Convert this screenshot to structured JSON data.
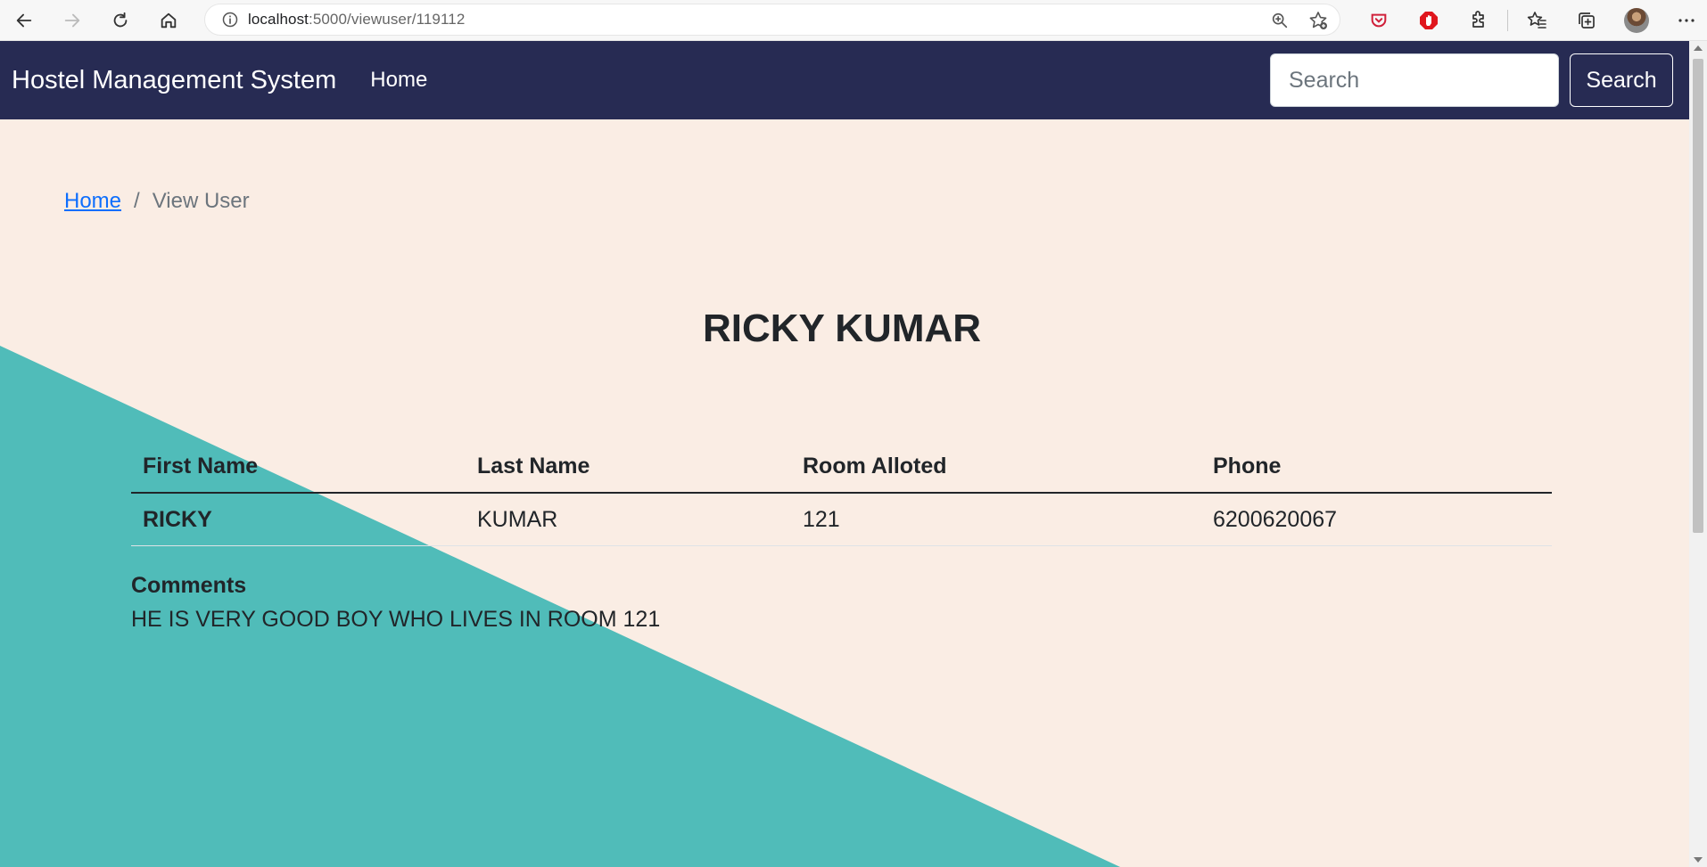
{
  "browser": {
    "url_host": "localhost",
    "url_path": ":5000/viewuser/119112"
  },
  "navbar": {
    "brand": "Hostel Management System",
    "home_link": "Home",
    "search_placeholder": "Search",
    "search_button": "Search"
  },
  "breadcrumb": {
    "home": "Home",
    "separator": "/",
    "current": "View User"
  },
  "user": {
    "title": "RICKY KUMAR"
  },
  "table": {
    "headers": [
      "First Name",
      "Last Name",
      "Room Alloted",
      "Phone"
    ],
    "row": {
      "first_name": "RICKY",
      "last_name": "KUMAR",
      "room": "121",
      "phone": "6200620067"
    }
  },
  "comments": {
    "label": "Comments",
    "text": "HE IS VERY GOOD BOY WHO LIVES IN ROOM 121"
  },
  "colors": {
    "navbar_bg": "#272b53",
    "page_bg": "#faede4",
    "teal_accent": "#50bcb9",
    "link": "#0d6efd"
  },
  "icons": [
    "back-icon",
    "forward-icon",
    "reload-icon",
    "home-icon",
    "info-icon",
    "zoom-icon",
    "favorite-add-icon",
    "pocket-icon",
    "opera-adblock-icon",
    "extensions-icon",
    "favorites-icon",
    "collections-icon",
    "profile-avatar",
    "more-menu-icon"
  ]
}
